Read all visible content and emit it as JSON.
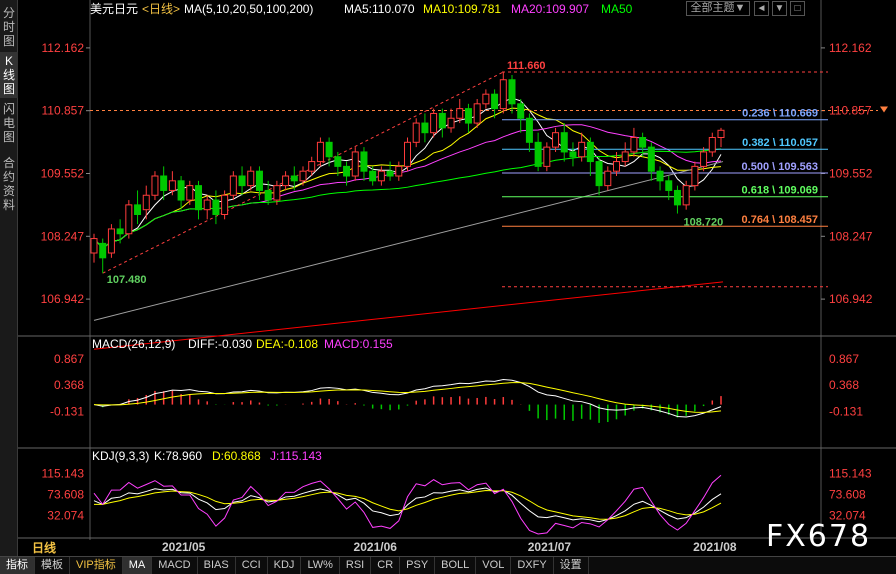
{
  "sidebar": {
    "tabs": [
      {
        "label": "分时图"
      },
      {
        "label": "K线图"
      },
      {
        "label": "闪电图"
      },
      {
        "label": "合约资料"
      }
    ]
  },
  "header": {
    "symbol": "美元日元",
    "period_tag": "<日线>",
    "ma_label": "MA(5,10,20,50,100,200)",
    "ma5": "MA5:110.070",
    "ma10": "MA10:109.781",
    "ma20": "MA20:109.907",
    "ma50": "MA50",
    "theme_button": "全部主题",
    "theme_arrow": "▼",
    "win_buttons": [
      "◄",
      "▼",
      "□"
    ]
  },
  "macd_header": {
    "name": "MACD(26,12,9)",
    "diff": "DIFF:-0.030",
    "dea": "DEA:-0.108",
    "macd": "MACD:0.155"
  },
  "kdj_header": {
    "name": "KDJ(9,3,3)",
    "k": "K:78.960",
    "d": "D:60.868",
    "j": "J:115.143"
  },
  "bottom": {
    "period": "日线",
    "tabs": [
      "指标",
      "模板",
      "VIP指标",
      "MA",
      "MACD",
      "BIAS",
      "CCI",
      "KDJ",
      "LW%",
      "RSI",
      "CR",
      "PSY",
      "BOLL",
      "VOL",
      "DXFY",
      "设置"
    ]
  },
  "watermark": "FX678",
  "colors": {
    "up": "#ff3b3b",
    "down": "#00c800",
    "ma5": "#ffffff",
    "ma10": "#ffff00",
    "ma20": "#ff40ff",
    "ma50": "#00ff00",
    "ma100": "#a0a0a0",
    "ma200": "#ff0000",
    "axis_text": "#ff4040",
    "high_label": "#ff4040",
    "low_label": "#60d060"
  },
  "chart_data": {
    "type": "candlestick",
    "price_axis_labels": [
      "112.162",
      "110.857",
      "109.552",
      "108.247",
      "106.942"
    ],
    "price_ylim": [
      106.3,
      112.7
    ],
    "x_labels": [
      "2021/05",
      "2021/06",
      "2021/07",
      "2021/08"
    ],
    "high_marker": "111.660",
    "low_marker": "107.480",
    "recent_low_marker": "108.720",
    "fibonacci": [
      {
        "label": "0.236 \\ 110.669",
        "value": 110.669,
        "color": "#7fa7ff"
      },
      {
        "label": "0.382 \\ 110.057",
        "value": 110.057,
        "color": "#4fc8ff"
      },
      {
        "label": "0.500 \\ 109.563",
        "value": 109.563,
        "color": "#a0a0ff"
      },
      {
        "label": "0.618 \\ 109.069",
        "value": 109.069,
        "color": "#60ff60"
      },
      {
        "label": "0.764 \\ 108.457",
        "value": 108.457,
        "color": "#ff8040"
      }
    ],
    "candles": [
      [
        107.9,
        108.2,
        107.7,
        108.3
      ],
      [
        108.1,
        107.8,
        107.48,
        108.2
      ],
      [
        107.9,
        108.4,
        107.8,
        108.5
      ],
      [
        108.4,
        108.3,
        108.1,
        108.6
      ],
      [
        108.3,
        108.9,
        108.2,
        109.0
      ],
      [
        108.9,
        108.7,
        108.5,
        109.2
      ],
      [
        108.8,
        109.1,
        108.6,
        109.3
      ],
      [
        109.1,
        109.5,
        109.0,
        109.6
      ],
      [
        109.5,
        109.2,
        109.0,
        109.7
      ],
      [
        109.2,
        109.4,
        109.1,
        109.6
      ],
      [
        109.4,
        109.0,
        108.8,
        109.5
      ],
      [
        109.0,
        109.3,
        108.9,
        109.4
      ],
      [
        109.3,
        108.8,
        108.6,
        109.4
      ],
      [
        108.8,
        109.0,
        108.6,
        109.1
      ],
      [
        109.0,
        108.7,
        108.5,
        109.2
      ],
      [
        108.7,
        109.1,
        108.6,
        109.2
      ],
      [
        109.1,
        109.5,
        109.0,
        109.6
      ],
      [
        109.5,
        109.3,
        109.1,
        109.7
      ],
      [
        109.3,
        109.6,
        109.2,
        109.7
      ],
      [
        109.6,
        109.2,
        109.0,
        109.7
      ],
      [
        109.2,
        109.0,
        108.9,
        109.4
      ],
      [
        109.0,
        109.3,
        108.9,
        109.4
      ],
      [
        109.3,
        109.5,
        109.2,
        109.6
      ],
      [
        109.5,
        109.4,
        109.2,
        109.7
      ],
      [
        109.4,
        109.6,
        109.3,
        109.7
      ],
      [
        109.6,
        109.8,
        109.5,
        109.9
      ],
      [
        109.8,
        110.2,
        109.7,
        110.3
      ],
      [
        110.2,
        109.9,
        109.7,
        110.3
      ],
      [
        109.9,
        109.7,
        109.5,
        110.0
      ],
      [
        109.7,
        109.5,
        109.3,
        109.8
      ],
      [
        109.5,
        110.0,
        109.4,
        110.1
      ],
      [
        110.0,
        109.6,
        109.4,
        110.1
      ],
      [
        109.6,
        109.4,
        109.3,
        109.7
      ],
      [
        109.4,
        109.6,
        109.3,
        109.7
      ],
      [
        109.6,
        109.5,
        109.4,
        109.8
      ],
      [
        109.5,
        109.7,
        109.4,
        109.8
      ],
      [
        109.7,
        110.2,
        109.6,
        110.3
      ],
      [
        110.2,
        110.6,
        110.1,
        110.7
      ],
      [
        110.6,
        110.4,
        110.2,
        110.8
      ],
      [
        110.4,
        110.8,
        110.3,
        110.9
      ],
      [
        110.8,
        110.5,
        110.3,
        110.9
      ],
      [
        110.5,
        110.7,
        110.4,
        110.9
      ],
      [
        110.7,
        110.9,
        110.6,
        111.1
      ],
      [
        110.9,
        110.6,
        110.4,
        111.0
      ],
      [
        110.6,
        111.0,
        110.5,
        111.1
      ],
      [
        111.0,
        111.2,
        110.9,
        111.3
      ],
      [
        111.2,
        110.9,
        110.7,
        111.3
      ],
      [
        110.9,
        111.5,
        110.8,
        111.66
      ],
      [
        111.5,
        111.0,
        110.8,
        111.6
      ],
      [
        111.0,
        110.7,
        110.4,
        111.1
      ],
      [
        110.7,
        110.2,
        110.0,
        110.8
      ],
      [
        110.2,
        109.7,
        109.6,
        110.4
      ],
      [
        109.7,
        110.1,
        109.6,
        110.2
      ],
      [
        110.1,
        110.4,
        110.0,
        110.5
      ],
      [
        110.4,
        110.0,
        109.8,
        110.6
      ],
      [
        110.0,
        109.9,
        109.7,
        110.2
      ],
      [
        109.9,
        110.2,
        109.8,
        110.4
      ],
      [
        110.2,
        109.8,
        109.5,
        110.3
      ],
      [
        109.8,
        109.3,
        109.1,
        109.9
      ],
      [
        109.3,
        109.6,
        109.2,
        109.7
      ],
      [
        109.6,
        109.8,
        109.5,
        110.0
      ],
      [
        109.8,
        110.0,
        109.7,
        110.2
      ],
      [
        110.0,
        110.3,
        109.9,
        110.5
      ],
      [
        110.3,
        110.1,
        109.9,
        110.4
      ],
      [
        110.1,
        109.6,
        109.4,
        110.2
      ],
      [
        109.6,
        109.4,
        109.2,
        109.7
      ],
      [
        109.4,
        109.2,
        109.0,
        109.5
      ],
      [
        109.2,
        108.9,
        108.72,
        109.3
      ],
      [
        108.9,
        109.3,
        108.8,
        109.4
      ],
      [
        109.3,
        109.7,
        109.2,
        109.8
      ],
      [
        109.7,
        110.0,
        109.6,
        110.1
      ],
      [
        110.0,
        110.3,
        109.9,
        110.4
      ],
      [
        110.3,
        110.45,
        110.1,
        110.5
      ]
    ],
    "macd_axis_labels": [
      "0.867",
      "0.368",
      "-0.131"
    ],
    "macd_ylim": [
      -0.75,
      1.0
    ],
    "kdj_axis_labels": [
      "115.143",
      "73.608",
      "32.074"
    ],
    "kdj_ylim": [
      -5,
      130
    ]
  }
}
